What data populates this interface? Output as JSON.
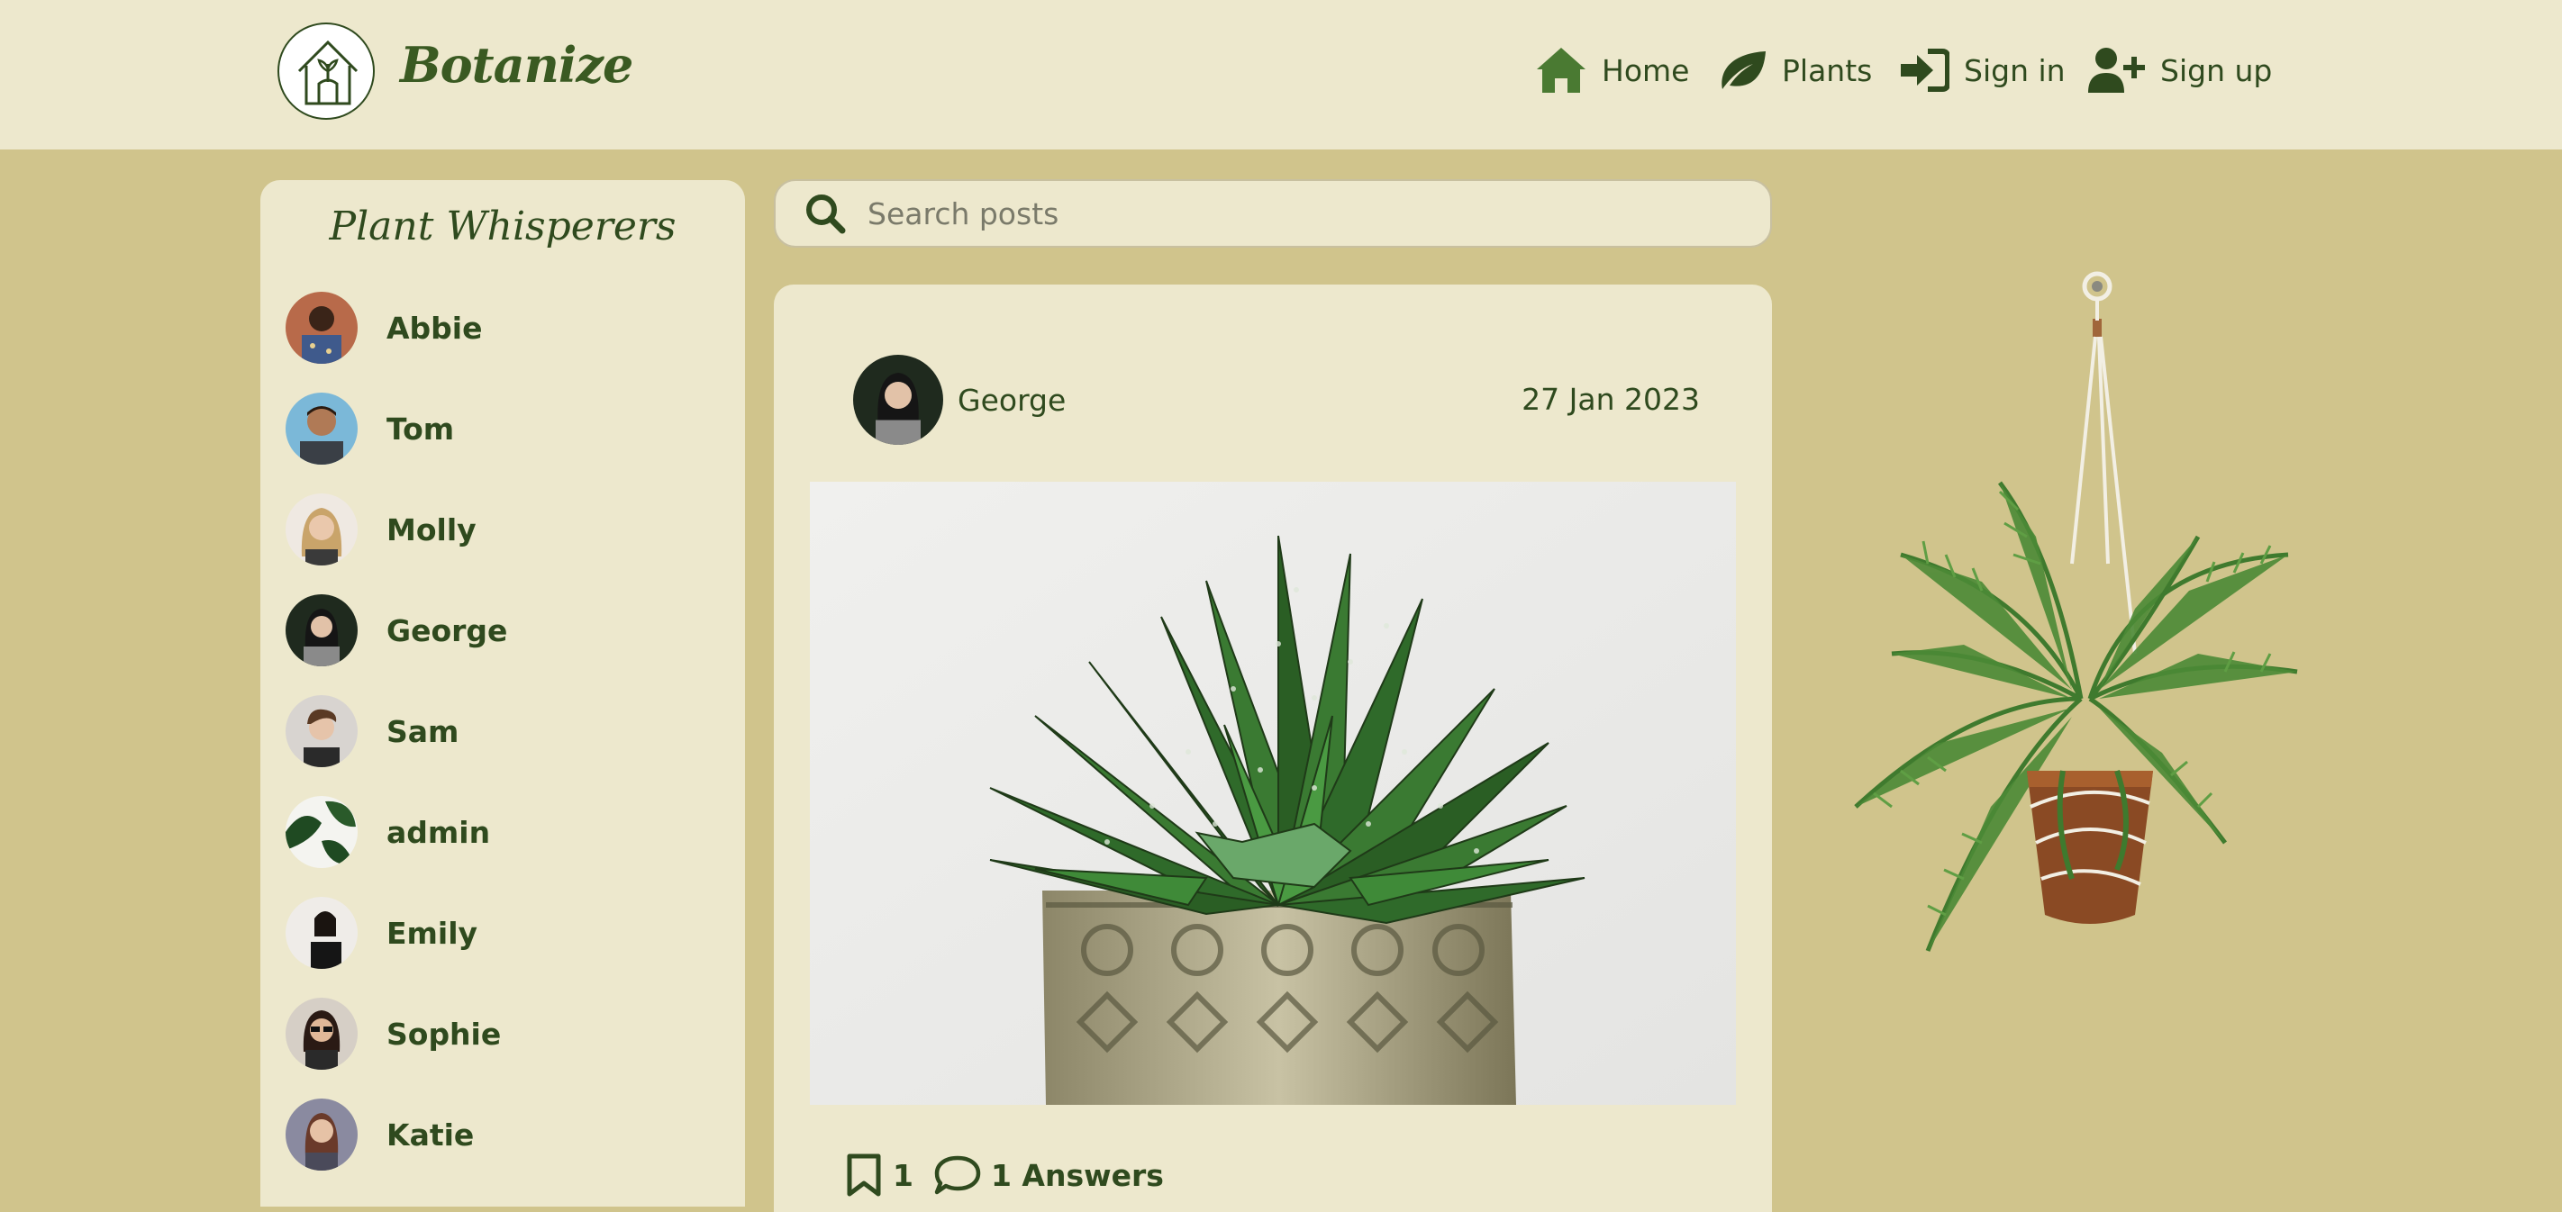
{
  "brand": {
    "name": "Botanize"
  },
  "nav": [
    {
      "label": "Home",
      "icon": "home-icon"
    },
    {
      "label": "Plants",
      "icon": "leaf-icon"
    },
    {
      "label": "Sign in",
      "icon": "sign-in-icon"
    },
    {
      "label": "Sign up",
      "icon": "user-plus-icon"
    }
  ],
  "sidebar": {
    "title": "Plant Whisperers",
    "users": [
      {
        "name": "Abbie"
      },
      {
        "name": "Tom"
      },
      {
        "name": "Molly"
      },
      {
        "name": "George"
      },
      {
        "name": "Sam"
      },
      {
        "name": "admin"
      },
      {
        "name": "Emily"
      },
      {
        "name": "Sophie"
      },
      {
        "name": "Katie"
      }
    ]
  },
  "search": {
    "placeholder": "Search posts",
    "value": ""
  },
  "post": {
    "author": "George",
    "date": "27 Jan 2023",
    "bookmark_count": "1",
    "answers_label": "1 Answers"
  },
  "colors": {
    "page_bg": "#d0c48c",
    "panel_bg": "#ede8cd",
    "text_green": "#2f4a1e",
    "icon_green": "#4a7a32"
  }
}
